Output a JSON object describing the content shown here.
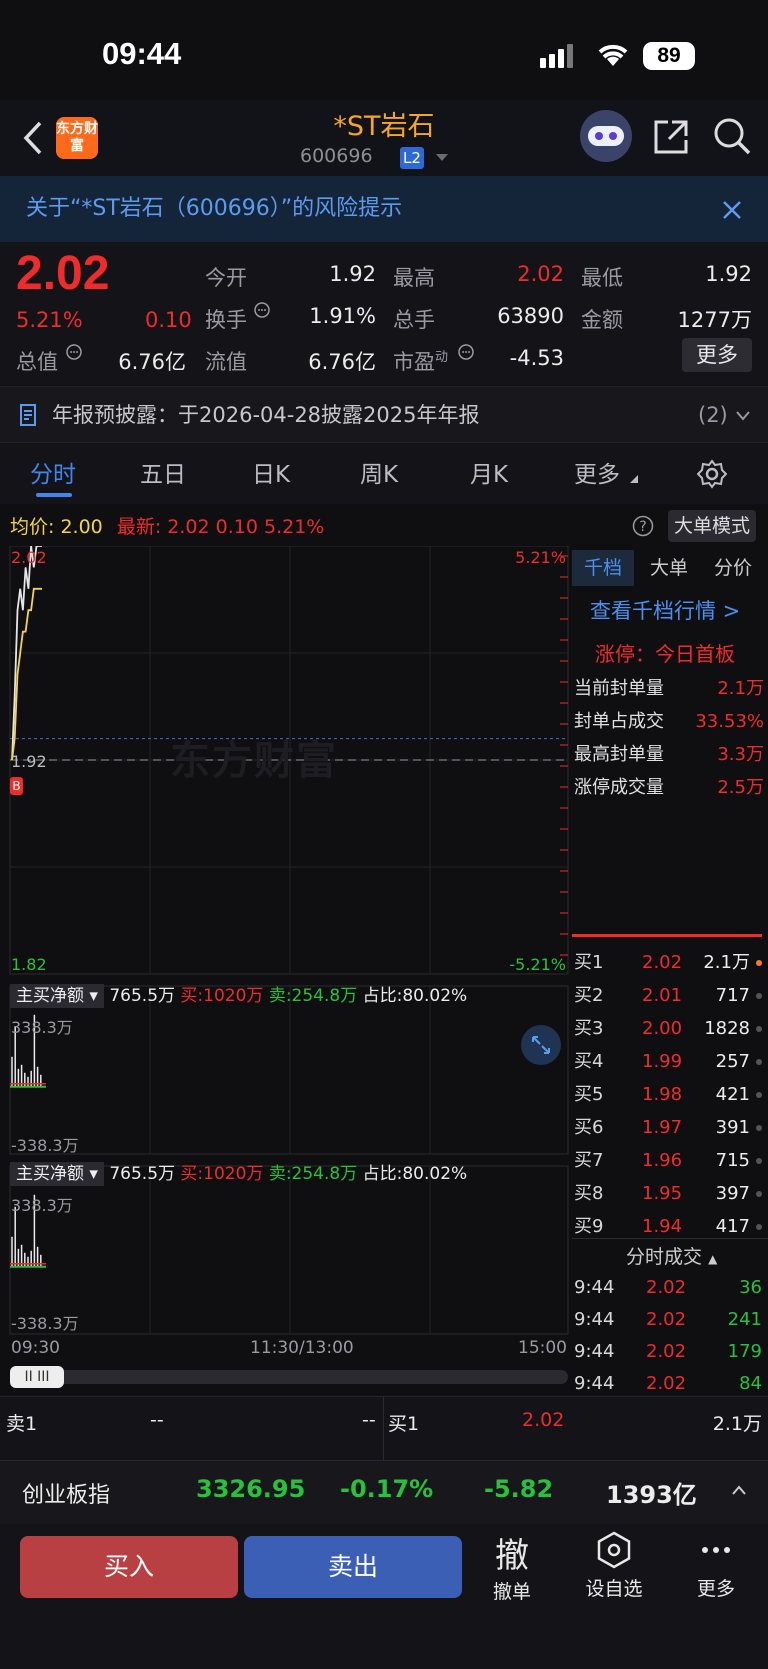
{
  "status": {
    "time": "09:44",
    "battery": "89"
  },
  "nav": {
    "logo": "东方财富",
    "title": "*ST岩石",
    "code": "600696",
    "level": "L2"
  },
  "risk_notice": "关于“*ST岩石（600696）”的风险提示",
  "quote": {
    "price": "2.02",
    "pct": "5.21%",
    "chg": "0.10",
    "zongzhi_label": "总值",
    "zongzhi": "6.76亿",
    "jinkai_label": "今开",
    "jinkai": "1.92",
    "huanshou_label": "换手",
    "huanshou": "1.91%",
    "liuzhi_label": "流值",
    "liuzhi": "6.76亿",
    "zuigao_label": "最高",
    "zuigao": "2.02",
    "zongshou_label": "总手",
    "zongshou": "63890",
    "shiying_label": "市盈",
    "shiying_sup": "动",
    "shiying": "-4.53",
    "zuidi_label": "最低",
    "zuidi": "1.92",
    "jine_label": "金额",
    "jine": "1277万",
    "more": "更多"
  },
  "notice": {
    "text": "年报预披露：于2026-04-28披露2025年年报",
    "count": "(2)"
  },
  "tabs": [
    "分时",
    "五日",
    "日K",
    "周K",
    "月K",
    "更多"
  ],
  "chart_info": {
    "avg_label": "均价:",
    "avg": "2.00",
    "latest_label": "最新:",
    "latest": "2.02",
    "chg": "0.10",
    "pct": "5.21%",
    "mode_btn": "大单模式"
  },
  "chart_data": {
    "type": "line",
    "title": "",
    "ylim": [
      1.82,
      2.02
    ],
    "y_left_ticks": [
      "2.02",
      "1.92",
      "1.82"
    ],
    "y_right_ticks": [
      "5.21%",
      "-5.21%"
    ],
    "x_ticks": [
      "09:30",
      "11:30/13:00",
      "15:00"
    ],
    "prev_close": 1.92,
    "series": [
      {
        "name": "最新",
        "values": [
          1.92,
          1.95,
          1.99,
          2.0,
          1.99,
          2.01,
          2.0,
          2.02,
          2.01,
          2.02,
          2.02,
          2.02
        ]
      },
      {
        "name": "均价",
        "values": [
          1.92,
          1.93,
          1.96,
          1.97,
          1.98,
          1.98,
          1.99,
          1.99,
          2.0,
          2.0,
          2.0,
          2.0
        ]
      }
    ]
  },
  "watermark": "东方财富",
  "sub1": {
    "label": "主买净额",
    "value": "765.5万",
    "buy": "买:1020万",
    "sell": "卖:254.8万",
    "ratio": "占比:80.02%",
    "top": "338.3万",
    "bottom": "-338.3万"
  },
  "sub2": {
    "label": "主买净额",
    "value": "765.5万",
    "buy": "买:1020万",
    "sell": "卖:254.8万",
    "ratio": "占比:80.02%",
    "top": "338.3万",
    "bottom": "-338.3万"
  },
  "side": {
    "tabs": [
      "千档",
      "大单",
      "分价"
    ],
    "link": "查看千档行情 >",
    "limit_title": "涨停：今日首板",
    "stats": [
      {
        "label": "当前封单量",
        "value": "2.1万"
      },
      {
        "label": "封单占成交",
        "value": "33.53%"
      },
      {
        "label": "最高封单量",
        "value": "3.3万"
      },
      {
        "label": "涨停成交量",
        "value": "2.5万"
      }
    ],
    "bids": [
      {
        "label": "买1",
        "price": "2.02",
        "vol": "2.1万"
      },
      {
        "label": "买2",
        "price": "2.01",
        "vol": "717"
      },
      {
        "label": "买3",
        "price": "2.00",
        "vol": "1828"
      },
      {
        "label": "买4",
        "price": "1.99",
        "vol": "257"
      },
      {
        "label": "买5",
        "price": "1.98",
        "vol": "421"
      },
      {
        "label": "买6",
        "price": "1.97",
        "vol": "391"
      },
      {
        "label": "买7",
        "price": "1.96",
        "vol": "715"
      },
      {
        "label": "买8",
        "price": "1.95",
        "vol": "397"
      },
      {
        "label": "买9",
        "price": "1.94",
        "vol": "417"
      }
    ],
    "trades_title": "分时成交",
    "trades": [
      {
        "time": "9:44",
        "price": "2.02",
        "vol": "36"
      },
      {
        "time": "9:44",
        "price": "2.02",
        "vol": "241"
      },
      {
        "time": "9:44",
        "price": "2.02",
        "vol": "179"
      },
      {
        "time": "9:44",
        "price": "2.02",
        "vol": "84"
      }
    ]
  },
  "slider": {
    "label": "II III"
  },
  "book_row": {
    "sell_label": "卖1",
    "sell_price": "--",
    "sell_vol": "--",
    "buy_label": "买1",
    "buy_price": "2.02",
    "buy_vol": "2.1万"
  },
  "index_bar": {
    "name": "创业板指",
    "value": "3326.95",
    "pct": "-0.17%",
    "chg": "-5.82",
    "amount": "1393亿"
  },
  "actions": {
    "buy": "买入",
    "sell": "卖出",
    "cancel_icon": "撤",
    "cancel": "撤单",
    "watch": "设自选",
    "more": "更多"
  }
}
